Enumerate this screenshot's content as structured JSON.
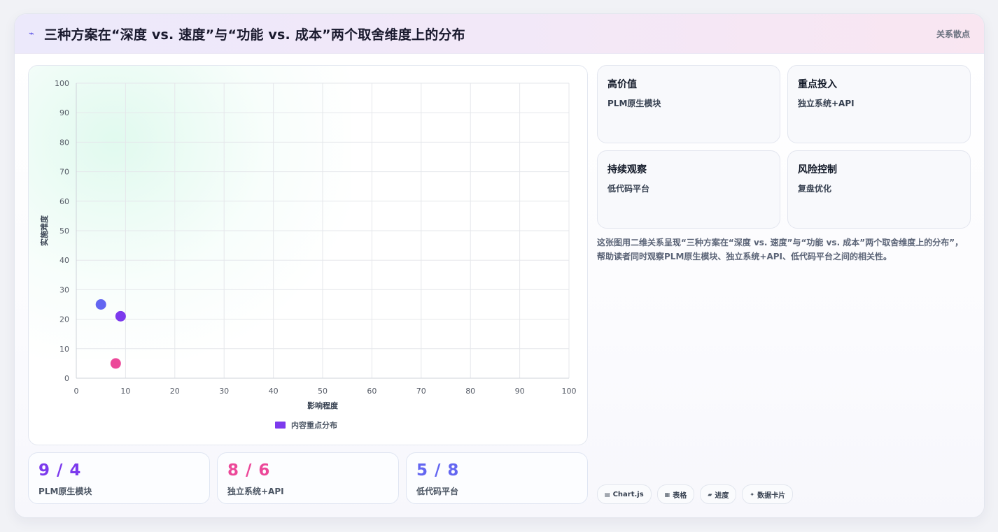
{
  "header": {
    "icon": "lightning-icon",
    "title": "三种方案在“深度 vs. 速度”与“功能 vs. 成本”两个取舍维度上的分布",
    "tag": "关系散点"
  },
  "chart_data": {
    "type": "scatter",
    "xlabel": "影响程度",
    "ylabel": "实施难度",
    "xlim": [
      0,
      100
    ],
    "ylim": [
      0,
      100
    ],
    "x_ticks": [
      0,
      10,
      20,
      30,
      40,
      50,
      60,
      70,
      80,
      90,
      100
    ],
    "y_ticks": [
      0,
      10,
      20,
      30,
      40,
      50,
      60,
      70,
      80,
      90,
      100
    ],
    "grid": true,
    "legend": "bottom",
    "series": [
      {
        "name": "内容重点分布",
        "color": "#7c3aed",
        "points": [
          {
            "label": "PLM原生模块",
            "x": 9,
            "y": 21,
            "color": "#7c3aed"
          },
          {
            "label": "独立系统+API",
            "x": 8,
            "y": 5,
            "color": "#ec4899"
          },
          {
            "label": "低代码平台",
            "x": 5,
            "y": 25,
            "color": "#6366f1"
          }
        ]
      }
    ]
  },
  "stats": [
    {
      "value": "9 / 4",
      "label": "PLM原生模块",
      "color": "#7c3aed"
    },
    {
      "value": "8 / 6",
      "label": "独立系统+API",
      "color": "#ec4899"
    },
    {
      "value": "5 / 8",
      "label": "低代码平台",
      "color": "#6366f1"
    }
  ],
  "quadrants": [
    {
      "title": "高价值",
      "value": "PLM原生模块",
      "tone": "green"
    },
    {
      "title": "重点投入",
      "value": "独立系统+API",
      "tone": "neutral"
    },
    {
      "title": "持续观察",
      "value": "低代码平台",
      "tone": "neutral"
    },
    {
      "title": "风险控制",
      "value": "复盘优化",
      "tone": "orange"
    }
  ],
  "description": "这张图用二维关系呈现“三种方案在“深度 vs. 速度”与“功能 vs. 成本”两个取舍维度上的分布”，帮助读者同时观察PLM原生模块、独立系统+API、低代码平台之间的相关性。",
  "chips": [
    {
      "icon": "chart-icon",
      "glyph": "▤",
      "label": "Chart.js"
    },
    {
      "icon": "table-icon",
      "glyph": "▦",
      "label": "表格"
    },
    {
      "icon": "progress-icon",
      "glyph": "▰",
      "label": "进度"
    },
    {
      "icon": "sparkle-icon",
      "glyph": "✦",
      "label": "数据卡片"
    }
  ]
}
